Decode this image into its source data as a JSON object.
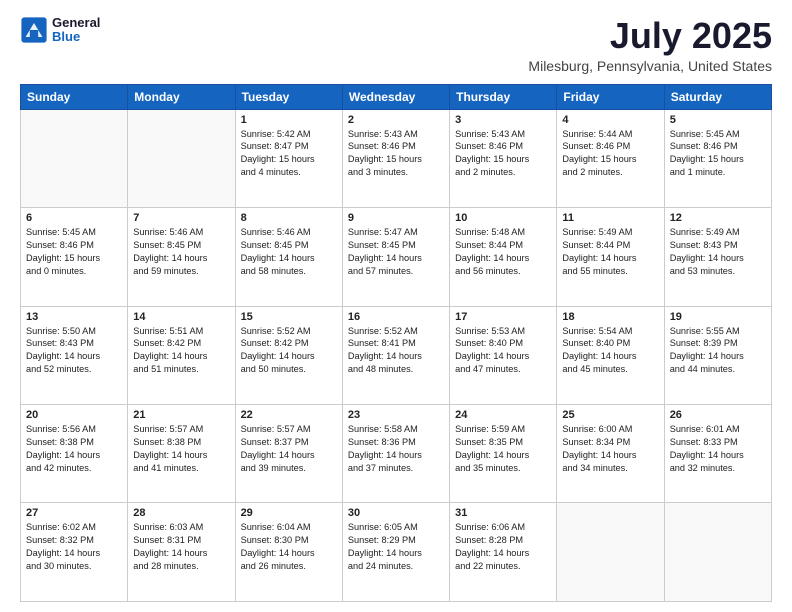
{
  "logo": {
    "general": "General",
    "blue": "Blue"
  },
  "title": "July 2025",
  "subtitle": "Milesburg, Pennsylvania, United States",
  "days_of_week": [
    "Sunday",
    "Monday",
    "Tuesday",
    "Wednesday",
    "Thursday",
    "Friday",
    "Saturday"
  ],
  "weeks": [
    [
      {
        "day": "",
        "info": ""
      },
      {
        "day": "",
        "info": ""
      },
      {
        "day": "1",
        "info": "Sunrise: 5:42 AM\nSunset: 8:47 PM\nDaylight: 15 hours\nand 4 minutes."
      },
      {
        "day": "2",
        "info": "Sunrise: 5:43 AM\nSunset: 8:46 PM\nDaylight: 15 hours\nand 3 minutes."
      },
      {
        "day": "3",
        "info": "Sunrise: 5:43 AM\nSunset: 8:46 PM\nDaylight: 15 hours\nand 2 minutes."
      },
      {
        "day": "4",
        "info": "Sunrise: 5:44 AM\nSunset: 8:46 PM\nDaylight: 15 hours\nand 2 minutes."
      },
      {
        "day": "5",
        "info": "Sunrise: 5:45 AM\nSunset: 8:46 PM\nDaylight: 15 hours\nand 1 minute."
      }
    ],
    [
      {
        "day": "6",
        "info": "Sunrise: 5:45 AM\nSunset: 8:46 PM\nDaylight: 15 hours\nand 0 minutes."
      },
      {
        "day": "7",
        "info": "Sunrise: 5:46 AM\nSunset: 8:45 PM\nDaylight: 14 hours\nand 59 minutes."
      },
      {
        "day": "8",
        "info": "Sunrise: 5:46 AM\nSunset: 8:45 PM\nDaylight: 14 hours\nand 58 minutes."
      },
      {
        "day": "9",
        "info": "Sunrise: 5:47 AM\nSunset: 8:45 PM\nDaylight: 14 hours\nand 57 minutes."
      },
      {
        "day": "10",
        "info": "Sunrise: 5:48 AM\nSunset: 8:44 PM\nDaylight: 14 hours\nand 56 minutes."
      },
      {
        "day": "11",
        "info": "Sunrise: 5:49 AM\nSunset: 8:44 PM\nDaylight: 14 hours\nand 55 minutes."
      },
      {
        "day": "12",
        "info": "Sunrise: 5:49 AM\nSunset: 8:43 PM\nDaylight: 14 hours\nand 53 minutes."
      }
    ],
    [
      {
        "day": "13",
        "info": "Sunrise: 5:50 AM\nSunset: 8:43 PM\nDaylight: 14 hours\nand 52 minutes."
      },
      {
        "day": "14",
        "info": "Sunrise: 5:51 AM\nSunset: 8:42 PM\nDaylight: 14 hours\nand 51 minutes."
      },
      {
        "day": "15",
        "info": "Sunrise: 5:52 AM\nSunset: 8:42 PM\nDaylight: 14 hours\nand 50 minutes."
      },
      {
        "day": "16",
        "info": "Sunrise: 5:52 AM\nSunset: 8:41 PM\nDaylight: 14 hours\nand 48 minutes."
      },
      {
        "day": "17",
        "info": "Sunrise: 5:53 AM\nSunset: 8:40 PM\nDaylight: 14 hours\nand 47 minutes."
      },
      {
        "day": "18",
        "info": "Sunrise: 5:54 AM\nSunset: 8:40 PM\nDaylight: 14 hours\nand 45 minutes."
      },
      {
        "day": "19",
        "info": "Sunrise: 5:55 AM\nSunset: 8:39 PM\nDaylight: 14 hours\nand 44 minutes."
      }
    ],
    [
      {
        "day": "20",
        "info": "Sunrise: 5:56 AM\nSunset: 8:38 PM\nDaylight: 14 hours\nand 42 minutes."
      },
      {
        "day": "21",
        "info": "Sunrise: 5:57 AM\nSunset: 8:38 PM\nDaylight: 14 hours\nand 41 minutes."
      },
      {
        "day": "22",
        "info": "Sunrise: 5:57 AM\nSunset: 8:37 PM\nDaylight: 14 hours\nand 39 minutes."
      },
      {
        "day": "23",
        "info": "Sunrise: 5:58 AM\nSunset: 8:36 PM\nDaylight: 14 hours\nand 37 minutes."
      },
      {
        "day": "24",
        "info": "Sunrise: 5:59 AM\nSunset: 8:35 PM\nDaylight: 14 hours\nand 35 minutes."
      },
      {
        "day": "25",
        "info": "Sunrise: 6:00 AM\nSunset: 8:34 PM\nDaylight: 14 hours\nand 34 minutes."
      },
      {
        "day": "26",
        "info": "Sunrise: 6:01 AM\nSunset: 8:33 PM\nDaylight: 14 hours\nand 32 minutes."
      }
    ],
    [
      {
        "day": "27",
        "info": "Sunrise: 6:02 AM\nSunset: 8:32 PM\nDaylight: 14 hours\nand 30 minutes."
      },
      {
        "day": "28",
        "info": "Sunrise: 6:03 AM\nSunset: 8:31 PM\nDaylight: 14 hours\nand 28 minutes."
      },
      {
        "day": "29",
        "info": "Sunrise: 6:04 AM\nSunset: 8:30 PM\nDaylight: 14 hours\nand 26 minutes."
      },
      {
        "day": "30",
        "info": "Sunrise: 6:05 AM\nSunset: 8:29 PM\nDaylight: 14 hours\nand 24 minutes."
      },
      {
        "day": "31",
        "info": "Sunrise: 6:06 AM\nSunset: 8:28 PM\nDaylight: 14 hours\nand 22 minutes."
      },
      {
        "day": "",
        "info": ""
      },
      {
        "day": "",
        "info": ""
      }
    ]
  ]
}
